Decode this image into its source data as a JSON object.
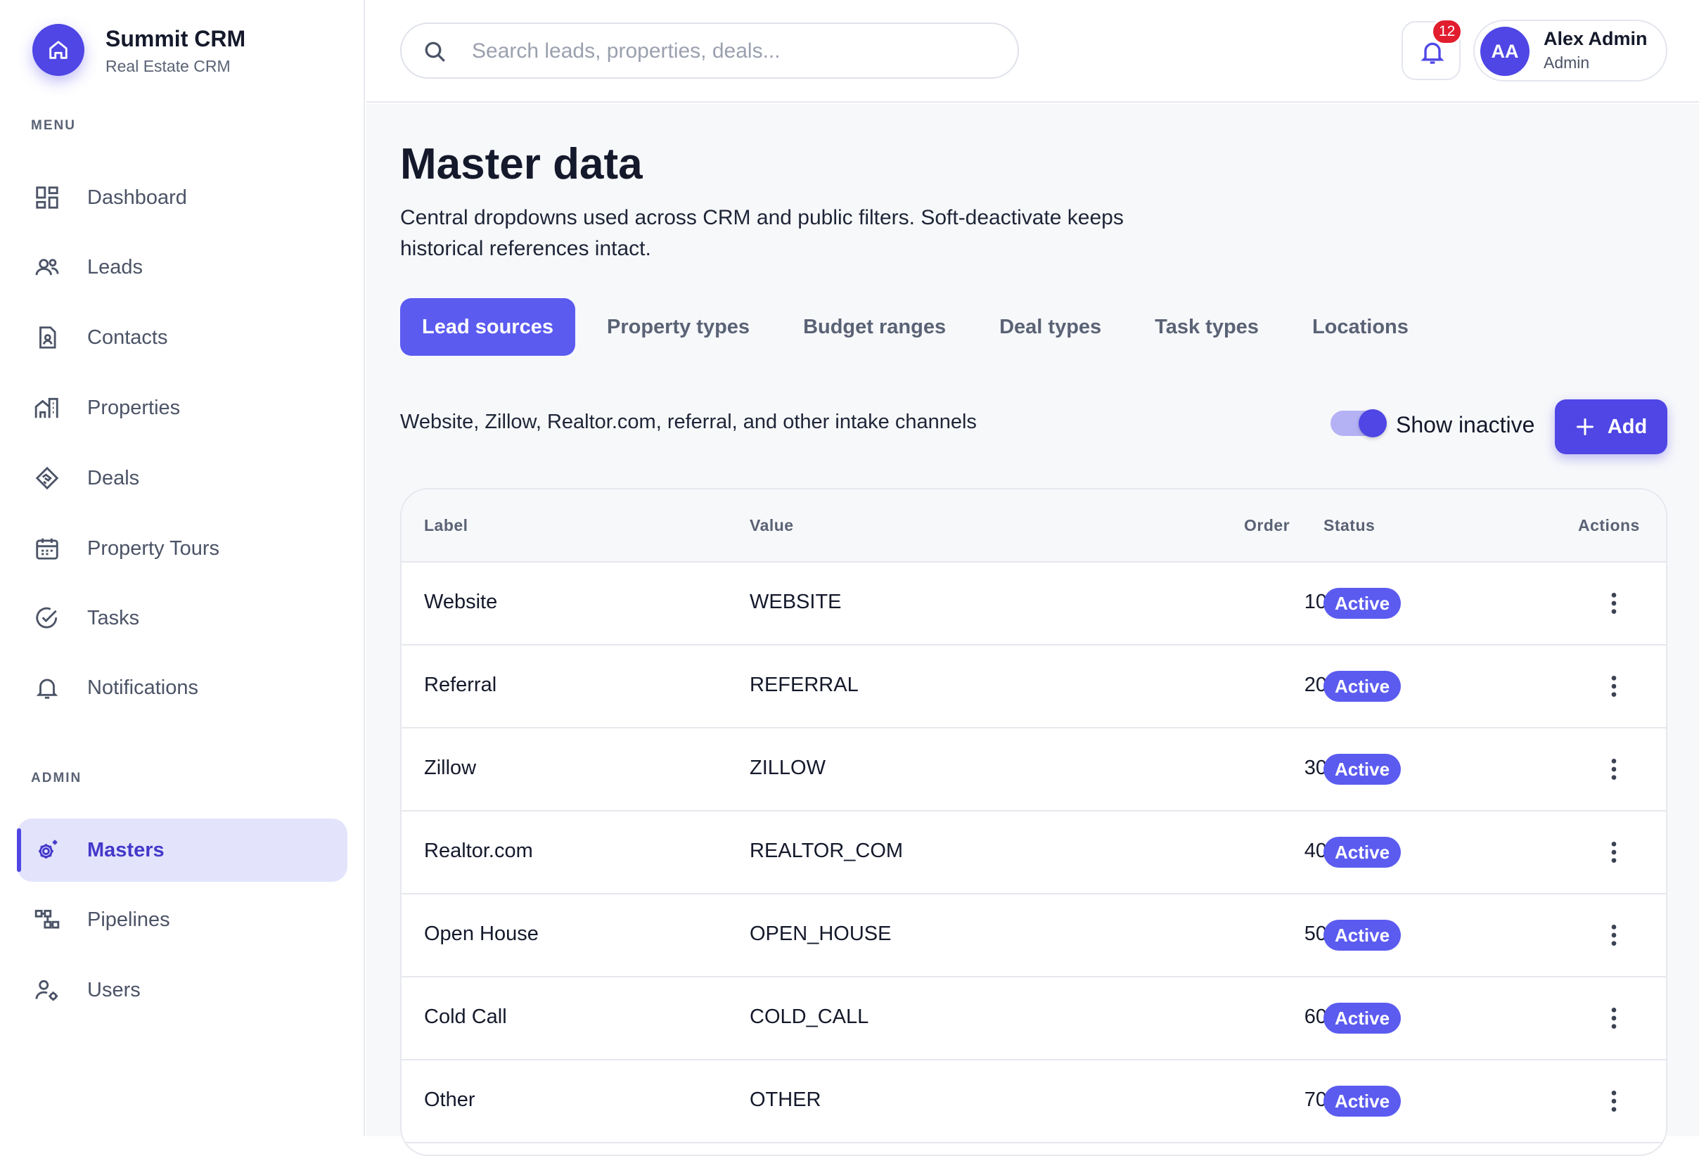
{
  "brand": {
    "name": "Summit CRM",
    "subtitle": "Real Estate CRM"
  },
  "sidebar": {
    "menu_label": "MENU",
    "admin_label": "ADMIN",
    "menu_items": [
      {
        "label": "Dashboard",
        "icon": "dashboard-icon"
      },
      {
        "label": "Leads",
        "icon": "users-icon"
      },
      {
        "label": "Contacts",
        "icon": "contact-card-icon"
      },
      {
        "label": "Properties",
        "icon": "buildings-icon"
      },
      {
        "label": "Deals",
        "icon": "handshake-icon"
      },
      {
        "label": "Property Tours",
        "icon": "calendar-icon"
      },
      {
        "label": "Tasks",
        "icon": "check-circle-icon"
      },
      {
        "label": "Notifications",
        "icon": "bell-icon"
      }
    ],
    "admin_items": [
      {
        "label": "Masters",
        "icon": "settings-gear-icon",
        "active": true
      },
      {
        "label": "Pipelines",
        "icon": "flow-icon"
      },
      {
        "label": "Users",
        "icon": "user-cog-icon"
      }
    ]
  },
  "topbar": {
    "search_placeholder": "Search leads, properties, deals...",
    "notification_count": "12",
    "user": {
      "initials": "AA",
      "name": "Alex Admin",
      "role": "Admin"
    }
  },
  "page": {
    "title": "Master data",
    "description": "Central dropdowns used across CRM and public filters. Soft-deactivate keeps historical references intact.",
    "tabs": [
      "Lead sources",
      "Property types",
      "Budget ranges",
      "Deal types",
      "Task types",
      "Locations"
    ],
    "active_tab": 0,
    "section_description": "Website, Zillow, Realtor.com, referral, and other intake channels",
    "show_inactive_label": "Show inactive",
    "show_inactive_on": true,
    "add_label": "Add"
  },
  "table": {
    "headers": {
      "label": "Label",
      "value": "Value",
      "order": "Order",
      "status": "Status",
      "actions": "Actions"
    },
    "rows": [
      {
        "label": "Website",
        "value": "WEBSITE",
        "order": "10",
        "status": "Active"
      },
      {
        "label": "Referral",
        "value": "REFERRAL",
        "order": "20",
        "status": "Active"
      },
      {
        "label": "Zillow",
        "value": "ZILLOW",
        "order": "30",
        "status": "Active"
      },
      {
        "label": "Realtor.com",
        "value": "REALTOR_COM",
        "order": "40",
        "status": "Active"
      },
      {
        "label": "Open House",
        "value": "OPEN_HOUSE",
        "order": "50",
        "status": "Active"
      },
      {
        "label": "Cold Call",
        "value": "COLD_CALL",
        "order": "60",
        "status": "Active"
      },
      {
        "label": "Other",
        "value": "OTHER",
        "order": "70",
        "status": "Active"
      }
    ]
  },
  "colors": {
    "accent": "#4f46e5",
    "tab_active": "#5b5bf0",
    "badge_active": "#5b5bf0",
    "notification_badge": "#e11d2e",
    "nav_active_bg": "#e3e4fc"
  }
}
